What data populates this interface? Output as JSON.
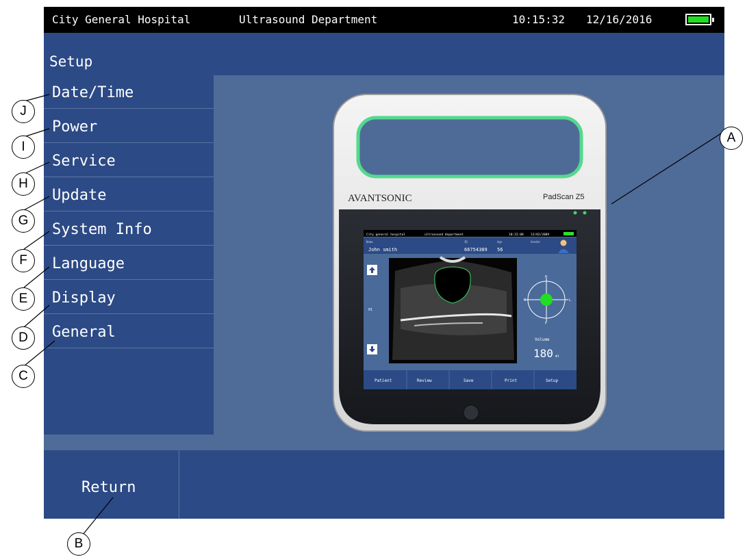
{
  "status_bar": {
    "hospital": "City General Hospital",
    "department": "Ultrasound Department",
    "time": "10:15:32",
    "date": "12/16/2016",
    "battery_icon": "battery-full-icon"
  },
  "header": {
    "title": "Setup"
  },
  "sidebar": {
    "items": [
      {
        "label": "Date/Time"
      },
      {
        "label": "Power"
      },
      {
        "label": "Service"
      },
      {
        "label": "Update"
      },
      {
        "label": "System Info"
      },
      {
        "label": "Language"
      },
      {
        "label": "Display"
      },
      {
        "label": "General"
      }
    ]
  },
  "footer": {
    "return_label": "Return"
  },
  "device": {
    "brand": "AVANTSONIC",
    "model": "PadScan Z5",
    "screen": {
      "hospital": "City general hospital",
      "department": "ultrasound department",
      "time": "10:22:08",
      "date": "12/02/2009",
      "name_label": "Name",
      "name": "John smith",
      "id_label": "ID",
      "id": "66754389",
      "age_label": "Age",
      "age": "56",
      "gender_label": "Gender",
      "frame": "01",
      "compass": {
        "top": "H",
        "bottom": "F",
        "left": "R",
        "right": "L"
      },
      "volume_label": "Volume",
      "volume_value": "180",
      "volume_unit": "ml",
      "nav": [
        "Patient",
        "Review",
        "Save",
        "Print",
        "Setup"
      ]
    }
  },
  "callouts": {
    "A": "A",
    "B": "B",
    "C": "C",
    "D": "D",
    "E": "E",
    "F": "F",
    "G": "G",
    "H": "H",
    "I": "I",
    "J": "J"
  },
  "colors": {
    "screen_bg": "#4f6b97",
    "panel_bg": "#2c4a85",
    "status_bg": "#000000",
    "battery_green": "#22dd22",
    "device_glow": "#4ed88a"
  }
}
